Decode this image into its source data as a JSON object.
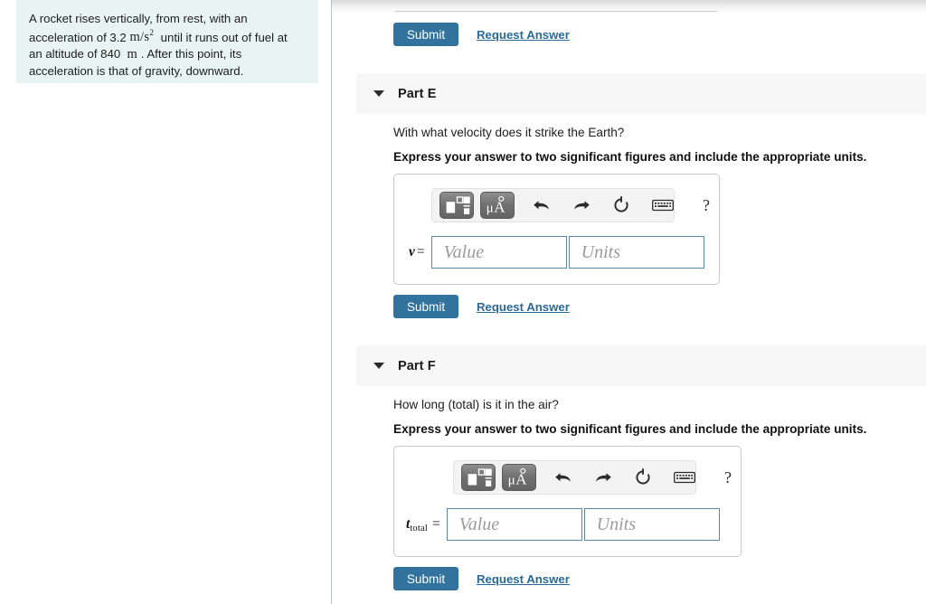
{
  "problem": {
    "text_before_accel": "A rocket rises vertically, from rest, with an acceleration of 3.2 ",
    "accel_value": "3.2",
    "accel_unit": "m/s",
    "accel_unit_exponent": "2",
    "text_mid": " until it runs out of fuel at an altitude of 840 ",
    "altitude_value": "840",
    "altitude_unit": "m",
    "text_after": ". After this point, its acceleration is that of gravity, downward.",
    "full_text": "A rocket rises vertically, from rest, with an acceleration of 3.2 m/s² until it runs out of fuel at an altitude of 840 m . After this point, its acceleration is that of gravity, downward."
  },
  "top_partial_section": {
    "submit_label": "Submit",
    "request_answer_label": "Request Answer"
  },
  "parts": [
    {
      "id": "E",
      "title": "Part E",
      "question": "With what velocity does it strike the Earth?",
      "instruction": "Express your answer to two significant figures and include the appropriate units.",
      "variable_symbol": "v",
      "variable_subscript": "",
      "equals_sign": "=",
      "value_placeholder": "Value",
      "units_placeholder": "Units",
      "value_current": "",
      "units_current": "",
      "submit_label": "Submit",
      "request_answer_label": "Request Answer",
      "toolbar": {
        "template_icon": "math-template-icon",
        "units_icon": "micro-angstrom-units-icon",
        "units_icon_label": "μÅ",
        "undo_icon": "undo-arrow-icon",
        "redo_icon": "redo-arrow-icon",
        "reset_icon": "reset-circular-arrow-icon",
        "keyboard_icon": "keyboard-icon",
        "help_icon": "question-mark-icon",
        "help_label": "?"
      }
    },
    {
      "id": "F",
      "title": "Part F",
      "question": "How long (total) is it in the air?",
      "instruction": "Express your answer to two significant figures and include the appropriate units.",
      "variable_symbol": "t",
      "variable_subscript": "total",
      "equals_sign": "=",
      "value_placeholder": "Value",
      "units_placeholder": "Units",
      "value_current": "",
      "units_current": "",
      "submit_label": "Submit",
      "request_answer_label": "Request Answer",
      "toolbar": {
        "template_icon": "math-template-icon",
        "units_icon": "micro-angstrom-units-icon",
        "units_icon_label": "μÅ",
        "undo_icon": "undo-arrow-icon",
        "redo_icon": "redo-arrow-icon",
        "reset_icon": "reset-circular-arrow-icon",
        "keyboard_icon": "keyboard-icon",
        "help_icon": "question-mark-icon",
        "help_label": "?"
      }
    }
  ],
  "colors": {
    "problem_card_bg": "#e8f4f1",
    "part_header_bg": "#f7f7f7",
    "submit_button_bg": "#31739c",
    "link_color": "#2b6a96",
    "field_border": "#5b87a8",
    "divider": "#b9c4d0"
  }
}
